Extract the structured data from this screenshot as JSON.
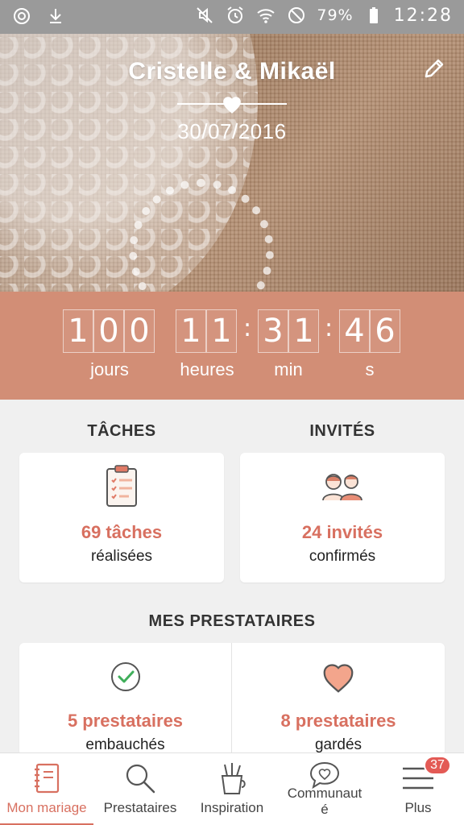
{
  "status_bar": {
    "battery": "79%",
    "time": "12:28",
    "icons": [
      "sync-icon",
      "download-icon",
      "mute-icon",
      "alarm-icon",
      "wifi-icon",
      "do-not-disturb-icon",
      "battery-icon"
    ]
  },
  "header": {
    "couple": "Cristelle & Mikaël",
    "date": "30/07/2016",
    "edit_icon": "pencil-icon"
  },
  "countdown": {
    "days": [
      "1",
      "0",
      "0"
    ],
    "hours": [
      "1",
      "1"
    ],
    "minutes": [
      "3",
      "1"
    ],
    "seconds": [
      "4",
      "6"
    ],
    "separator": ":",
    "labels": {
      "days": "jours",
      "hours": "heures",
      "minutes": "min",
      "seconds": "s"
    }
  },
  "tasks": {
    "title": "TÂCHES",
    "value": "69 tâches",
    "sub": "réalisées",
    "icon": "clipboard-icon"
  },
  "guests": {
    "title": "INVITÉS",
    "value": "24 invités",
    "sub": "confirmés",
    "icon": "couple-icon"
  },
  "vendors": {
    "title": "MES PRESTATAIRES",
    "hired": {
      "value": "5 prestataires",
      "sub": "embauchés",
      "icon": "check-circle-icon"
    },
    "saved": {
      "value": "8 prestataires",
      "sub": "gardés",
      "icon": "heart-icon"
    }
  },
  "nav": {
    "items": [
      {
        "label": "Mon mariage",
        "icon": "notebook-icon",
        "active": true
      },
      {
        "label": "Prestataires",
        "icon": "search-icon",
        "active": false
      },
      {
        "label": "Inspiration",
        "icon": "pencil-cup-icon",
        "active": false
      },
      {
        "label": "Communaut\né",
        "icon": "chat-heart-icon",
        "active": false
      },
      {
        "label": "Plus",
        "icon": "menu-icon",
        "active": false
      }
    ],
    "badge": "37"
  },
  "colors": {
    "accent": "#d87060",
    "countdown_bg": "#d28e76",
    "status_bar": "#9a9a9a"
  }
}
